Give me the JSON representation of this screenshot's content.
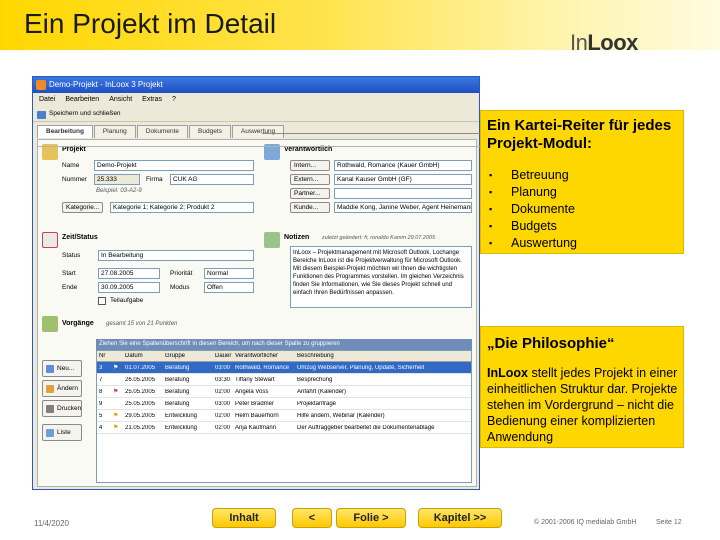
{
  "slide": {
    "title": "Ein Projekt im Detail",
    "logo_prefix": "In",
    "logo_suffix": "Loox"
  },
  "app": {
    "window_title": "Demo-Projekt - InLoox 3 Projekt",
    "menu": [
      "Datei",
      "Bearbeiten",
      "Ansicht",
      "Extras",
      "?"
    ],
    "toolbar_button": "Speichern und schließen",
    "tabs": [
      "Bearbeitung",
      "Planung",
      "Dokumente",
      "Budgets",
      "Auswertung"
    ],
    "project": {
      "section": "Projekt",
      "name_label": "Name",
      "name_value": "Demo-Projekt",
      "nummer_label": "Nummer",
      "nummer_value": "25.333",
      "firma_label": "Firma",
      "firma_value": "CUK AG",
      "beispiel": "Beispiel: 03-A2-9",
      "kategorie_label": "Kategorie...",
      "kategorie_value": "Kategorie 1; Kategorie 2; Produkt 2"
    },
    "verantwortlich": {
      "section": "Verantwortlich",
      "buttons": [
        "Intern...",
        "Extern...",
        "Partner...",
        "Kunde..."
      ],
      "values": [
        "Rothwald, Romance (Kauer GmbH)",
        "Kanal Kauser GmbH (GF)",
        "",
        "Maddie Kong, Janine Weber, Agent Heinemann"
      ]
    },
    "zeit": {
      "section": "Zeit/Status",
      "status_label": "Status",
      "status_value": "In Bearbeitung",
      "start_label": "Start",
      "start_value": "27.08.2005",
      "ende_label": "Ende",
      "ende_value": "30.09.2005",
      "prio_label": "Priorität",
      "prio_value": "Normal",
      "modus_label": "Modus",
      "modus_value": "Offen",
      "checkbox_label": "Teilaufgabe"
    },
    "notizen": {
      "section": "Notizen",
      "meta": "zuletzt geändert: fr, ronaldo Kamm 29.07.2005",
      "text": "InLoox – Projektmanagement mit Microsoft Outlook. Lochange Bereiche\n\nInLoox ist die Projektverwaltung für Microsoft Outlook. Mit diesem Beispiel-Projekt möchten wir Ihnen die wichtigsten Funktionen des Programmes vorstellen. Im gleichen Verzeichnis finden Sie Informationen, wie Sie dieses Projekt schnell und einfach Ihren Bedürfnissen anpassen."
    },
    "vorgaenge": {
      "section": "Vorgänge",
      "meta": "gesamt 15 von 21 Punkten",
      "group_band": "Ziehen Sie eine Spaltenüberschrift in diesen Bereich, um nach dieser Spalte zu gruppieren",
      "side_buttons": [
        "Neu...",
        "Ändern",
        "Drucken",
        "Liste"
      ],
      "columns": [
        "Nr",
        "",
        "Datum",
        "Gruppe",
        "Dauer",
        "Verantwortlicher",
        "Beschreibung"
      ],
      "rows": [
        {
          "nr": "3",
          "date": "01.07.2005",
          "group": "Beratung",
          "dur": "03:00",
          "resp": "Rothwald, Romance",
          "desc": "Umzug Webserver, Planung, Update, Sicherheit"
        },
        {
          "nr": "7",
          "date": "26.05.2005",
          "group": "Beratung",
          "dur": "03:30",
          "resp": "Tiffany Stewart",
          "desc": "Besprechung"
        },
        {
          "nr": "8",
          "date": "25.05.2005",
          "group": "Beratung",
          "dur": "02:00",
          "resp": "Angela Voss",
          "desc": "Anfahrt (Kalender)"
        },
        {
          "nr": "9",
          "date": "25.05.2005",
          "group": "Beratung",
          "dur": "03:00",
          "resp": "Peter Bradmer",
          "desc": "Projektanfrage"
        },
        {
          "nr": "5",
          "date": "29.05.2005",
          "group": "Entwicklung",
          "dur": "02:00",
          "resp": "Helm Bauerhorn",
          "desc": "Hilfe ändern, Webinar (Kalender)"
        },
        {
          "nr": "4",
          "date": "21.05.2005",
          "group": "Entwicklung",
          "dur": "02:00",
          "resp": "Anja Kaufmann",
          "desc": "Der Auftraggeber bearbeitet die Dokumentenablage"
        }
      ]
    }
  },
  "callouts": {
    "tabs_title": "Ein Kartei-Reiter für jedes Projekt-Modul:",
    "tabs_items": [
      "Betreuung",
      "Planung",
      "Dokumente",
      "Budgets",
      "Auswertung"
    ],
    "philosophy_title": "„Die Philosophie“",
    "philosophy_brand": "InLoox",
    "philosophy_text": " stellt jedes Projekt in einer einheitlichen Struktur dar. Projekte stehen im Vordergrund – nicht die Bedienung einer komplizierten Anwendung"
  },
  "footer": {
    "date": "11/4/2020",
    "nav": [
      "Inhalt",
      "<",
      "Folie >",
      "Kapitel >>"
    ],
    "copyright": "© 2001-2006 IQ medialab GmbH",
    "page": "Seite 12"
  },
  "colors": {
    "accent_yellow": "#ffd700",
    "xp_blue": "#1e4fc4",
    "selection_blue": "#316ac5"
  }
}
